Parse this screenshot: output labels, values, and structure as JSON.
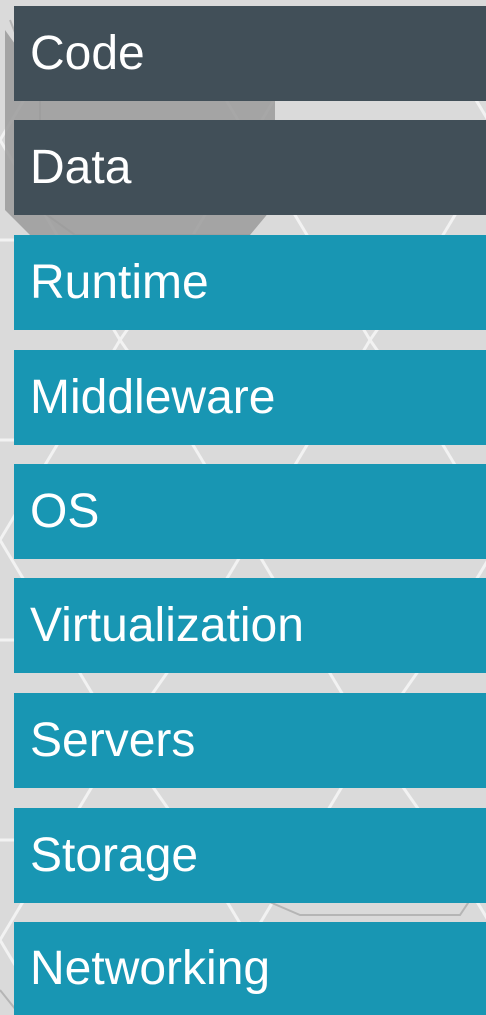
{
  "layers": [
    {
      "label": "Code",
      "color": "#414f58"
    },
    {
      "label": "Data",
      "color": "#414f58"
    },
    {
      "label": "Runtime",
      "color": "#1896b3"
    },
    {
      "label": "Middleware",
      "color": "#1896b3"
    },
    {
      "label": "OS",
      "color": "#1896b3"
    },
    {
      "label": "Virtualization",
      "color": "#1896b3"
    },
    {
      "label": "Servers",
      "color": "#1896b3"
    },
    {
      "label": "Storage",
      "color": "#1896b3"
    },
    {
      "label": "Networking",
      "color": "#1896b3"
    }
  ]
}
